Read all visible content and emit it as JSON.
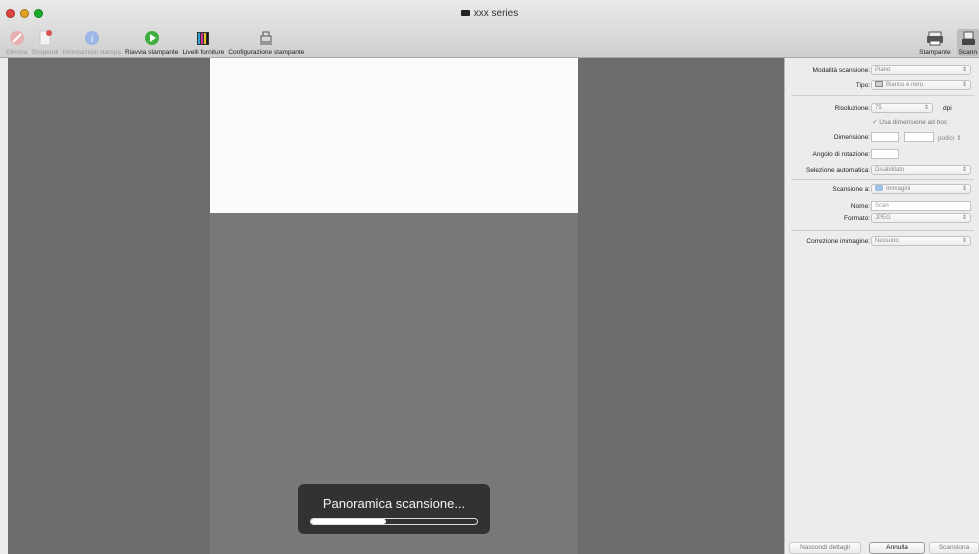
{
  "window": {
    "title": "xxx series"
  },
  "toolbar": {
    "items": [
      {
        "label": "Elimina",
        "icon": "delete-icon",
        "enabled": false
      },
      {
        "label": "Sospendi",
        "icon": "pause-icon",
        "enabled": false
      },
      {
        "label": "Informazioni stampa",
        "icon": "info-icon",
        "enabled": false
      },
      {
        "label": "Riavvia stampante",
        "icon": "play-icon",
        "enabled": true
      },
      {
        "label": "Livelli forniture",
        "icon": "supply-levels-icon",
        "enabled": true
      },
      {
        "label": "Configurazione stampante",
        "icon": "printer-setup-icon",
        "enabled": true
      }
    ],
    "right_items": [
      {
        "label": "Stampante",
        "icon": "printer-icon"
      },
      {
        "label": "Scann",
        "icon": "scanner-icon"
      }
    ]
  },
  "hud": {
    "label": "Panoramica scansione...",
    "progress": 0.45
  },
  "panel": {
    "mode_label": "Modalità scansione:",
    "mode_value": "Piano",
    "type_label": "Tipo:",
    "type_value": "Bianco e nero",
    "resolution_label": "Risoluzione:",
    "resolution_value": "75",
    "resolution_unit": "dpi",
    "custom_size_label": "Usa dimensione ad hoc",
    "custom_size_checked": true,
    "size_label": "Dimensione:",
    "size_unit": "pollici",
    "rotation_label": "Angolo di rotazione:",
    "autoselect_label": "Selezione automatica:",
    "autoselect_value": "Disabilitato",
    "scan_to_label": "Scansione a:",
    "scan_to_value": "Immagini",
    "name_label": "Nome:",
    "name_value": "Scan",
    "format_label": "Formato:",
    "format_value": "JPEG",
    "correction_label": "Correzione immagine:",
    "correction_value": "Nessuno"
  },
  "buttons": {
    "hide_details": "Nascondi dettagli",
    "cancel": "Annulla",
    "scan": "Scansiona"
  }
}
